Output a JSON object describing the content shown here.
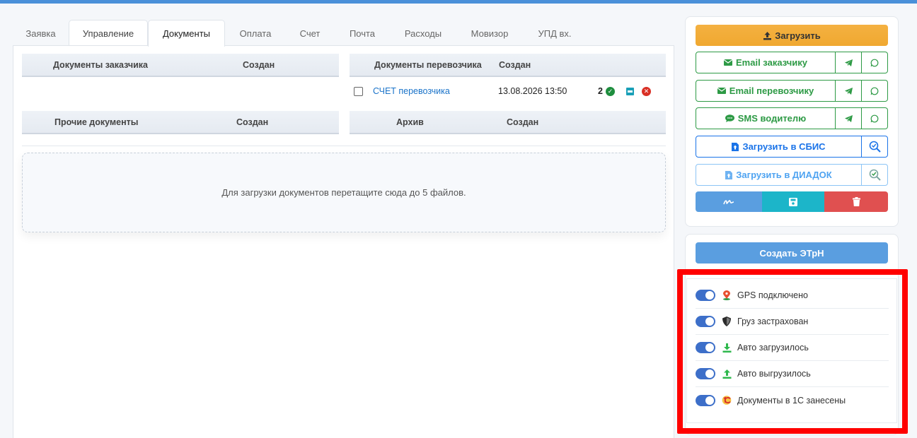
{
  "tabs": [
    {
      "label": "Заявка",
      "state": "inactive"
    },
    {
      "label": "Управление",
      "state": "soft"
    },
    {
      "label": "Документы",
      "state": "active"
    },
    {
      "label": "Оплата",
      "state": "inactive"
    },
    {
      "label": "Счет",
      "state": "inactive"
    },
    {
      "label": "Почта",
      "state": "inactive"
    },
    {
      "label": "Расходы",
      "state": "inactive"
    },
    {
      "label": "Мовизор",
      "state": "inactive"
    },
    {
      "label": "УПД вх.",
      "state": "inactive"
    }
  ],
  "customer_docs": {
    "col1": "Документы заказчика",
    "col2": "Создан"
  },
  "carrier_docs": {
    "col1": "Документы перевозчика",
    "col2": "Создан",
    "rows": [
      {
        "name": "СЧЕТ перевозчика",
        "created": "13.08.2026 13:50",
        "count": "2"
      }
    ]
  },
  "other_docs": {
    "col1": "Прочие документы",
    "col2": "Создан"
  },
  "archive": {
    "col1": "Архив",
    "col2": "Создан"
  },
  "dropzone_text": "Для загрузки документов перетащите сюда до 5 файлов.",
  "actions": {
    "upload": "Загрузить",
    "email_customer": "Email заказчику",
    "email_carrier": "Email перевозчику",
    "sms_driver": "SMS водителю",
    "upload_sbis": "Загрузить в СБИС",
    "upload_diadoc": "Загрузить в ДИАДОК",
    "create_etrn": "Создать ЭТрН"
  },
  "toggles": [
    {
      "label": "GPS подключено",
      "icon": "map-pin-icon",
      "on": true
    },
    {
      "label": "Груз застрахован",
      "icon": "shield-icon",
      "on": true
    },
    {
      "label": "Авто загрузилось",
      "icon": "download-icon",
      "on": true
    },
    {
      "label": "Авто выгрузилось",
      "icon": "upload-icon",
      "on": true
    },
    {
      "label": "Документы в 1С занесены",
      "icon": "1c-logo-icon",
      "on": true
    }
  ],
  "colors": {
    "accent_blue": "#3d6fc9",
    "orange": "#f0a830",
    "green": "#2d9a45",
    "teal": "#1cb5c9",
    "red": "#e05050",
    "highlight": "#ff0000"
  }
}
